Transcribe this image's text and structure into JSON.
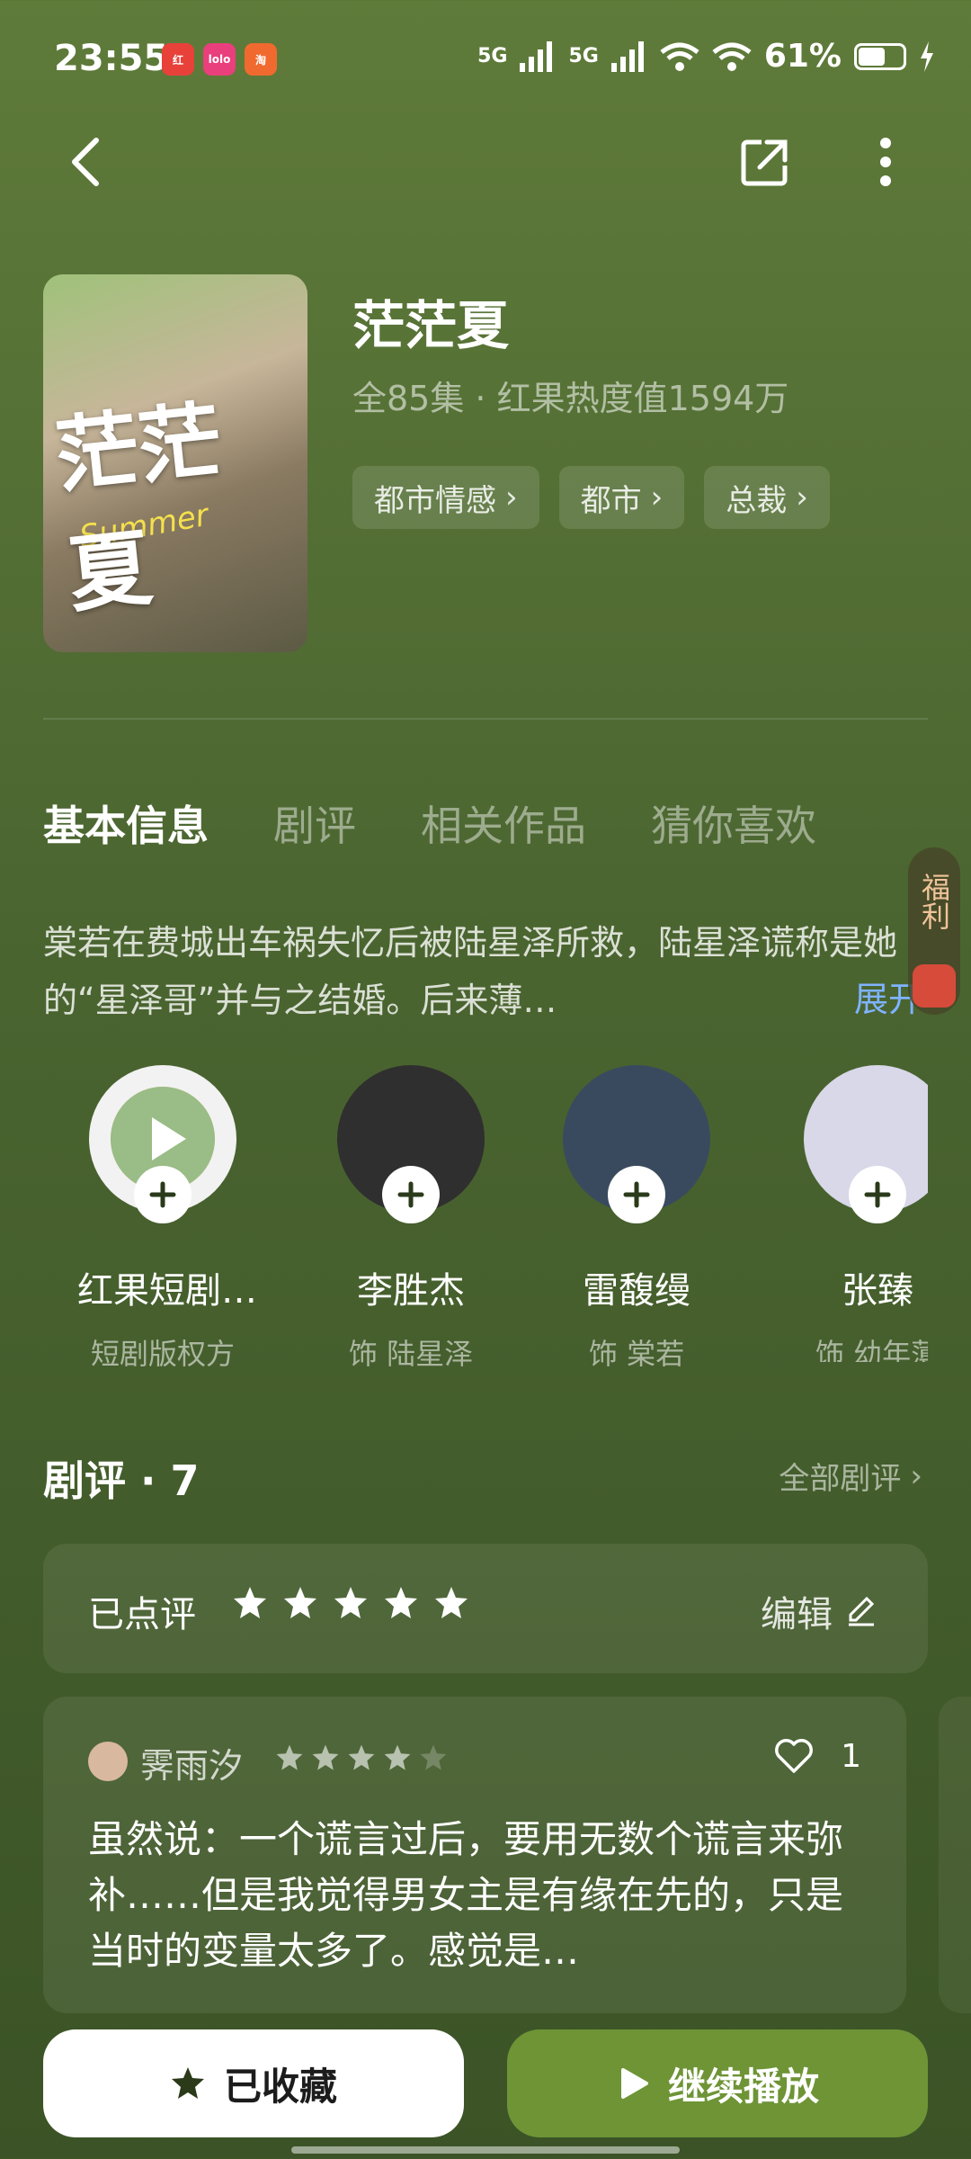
{
  "status": {
    "time": "23:55",
    "apps": [
      {
        "icon": "app-icon-red",
        "color": "#e8413a",
        "label": "红"
      },
      {
        "icon": "app-icon-pink",
        "color": "#e93f7c",
        "label": "lolo"
      },
      {
        "icon": "app-icon-orange",
        "color": "#f06a30",
        "label": "淘"
      }
    ],
    "signal1": "5G",
    "signal2": "5G",
    "battery": "61%",
    "battery_level": 0.61
  },
  "nav": {
    "back_icon": "back-icon",
    "share_icon": "share-icon",
    "more_icon": "more-icon"
  },
  "drama": {
    "poster_title": "茫茫夏",
    "poster_sub": "Summer",
    "title": "茫茫夏",
    "meta": "全85集 · 红果热度值1594万",
    "tags": [
      "都市情感",
      "都市",
      "总裁"
    ]
  },
  "tabs": [
    {
      "label": "基本信息",
      "active": true
    },
    {
      "label": "剧评",
      "active": false
    },
    {
      "label": "相关作品",
      "active": false
    },
    {
      "label": "猜你喜欢",
      "active": false
    }
  ],
  "synopsis": {
    "text": "棠若在费城出车祸失忆后被陆星泽所救，陆星泽谎称是她的“星泽哥”并与之结婚。后来薄…",
    "expand": "展开"
  },
  "welfare": {
    "label": "福利"
  },
  "cast": [
    {
      "name": "红果短剧…",
      "role": "短剧版权方",
      "color": "#f2f2f2"
    },
    {
      "name": "李胜杰",
      "role": "饰 陆星泽",
      "color": "#2f2f2f"
    },
    {
      "name": "雷馥缦",
      "role": "饰 棠若",
      "color": "#3a4a5e"
    },
    {
      "name": "张臻",
      "role": "饰 幼年薄",
      "color": "#d8d8e8"
    }
  ],
  "reviews": {
    "title": "剧评 · 7",
    "all_label": "全部剧评",
    "rated_label": "已点评",
    "rated_stars": 5,
    "edit_label": "编辑",
    "items": [
      {
        "user": "霁雨汐",
        "stars": 4,
        "likes": "1",
        "text": "虽然说：一个谎言过后，要用无数个谎言来弥补……但是我觉得男女主是有缘在先的，只是当时的变量太多了。感觉是…"
      }
    ]
  },
  "actions": {
    "favorite_label": "已收藏",
    "play_label": "继续播放"
  }
}
